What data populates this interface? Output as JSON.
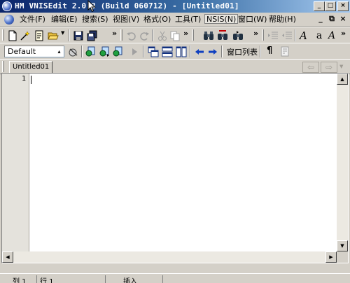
{
  "window": {
    "title": "HM VNISEdit 2.0.3 (Build 060712) - [Untitled01]",
    "controls": {
      "minimize": "_",
      "maximize": "□",
      "close": "×"
    }
  },
  "menu": {
    "items": [
      {
        "label": "文件(F)"
      },
      {
        "label": "编辑(E)"
      },
      {
        "label": "搜索(S)"
      },
      {
        "label": "视图(V)"
      },
      {
        "label": "格式(O)"
      },
      {
        "label": "工具(T)"
      },
      {
        "label": "NSIS(N)"
      },
      {
        "label": "窗口(W)"
      },
      {
        "label": "帮助(H)"
      }
    ],
    "mdi_controls": {
      "minimize": "_",
      "restore": "⧉",
      "close": "×"
    }
  },
  "toolbar1": {
    "icons": [
      "new-file-icon",
      "new-wizard-icon",
      "template-icon",
      "open-folder-icon",
      "save-icon",
      "save-all-icon",
      "undo-icon",
      "redo-icon",
      "cut-icon",
      "copy-icon",
      "paste-icon",
      "find-icon",
      "find-replace-icon",
      "find-next-icon",
      "indent-icon",
      "outdent-icon",
      "font-italic-icon",
      "font-a-icon",
      "font-size-icon"
    ],
    "overflow": "»"
  },
  "toolbar2": {
    "syntax_combo_value": "Default",
    "window_list_label": "窗口列表",
    "paragraph_label": "¶",
    "overflow": "»"
  },
  "tabs": [
    {
      "label": "Untitled01"
    }
  ],
  "tab_nav": {
    "back": "⇦",
    "forward": "⇨"
  },
  "editor": {
    "line_numbers": [
      "1"
    ]
  },
  "scrollbars": {
    "up": "▲",
    "down": "▼",
    "left": "◀",
    "right": "▶"
  },
  "status": {
    "cells": [
      "",
      "列 1",
      "行 1",
      "",
      "插入"
    ]
  },
  "colors": {
    "title_start": "#0a246a",
    "title_end": "#a6caf0",
    "chrome": "#d4d0c8"
  }
}
